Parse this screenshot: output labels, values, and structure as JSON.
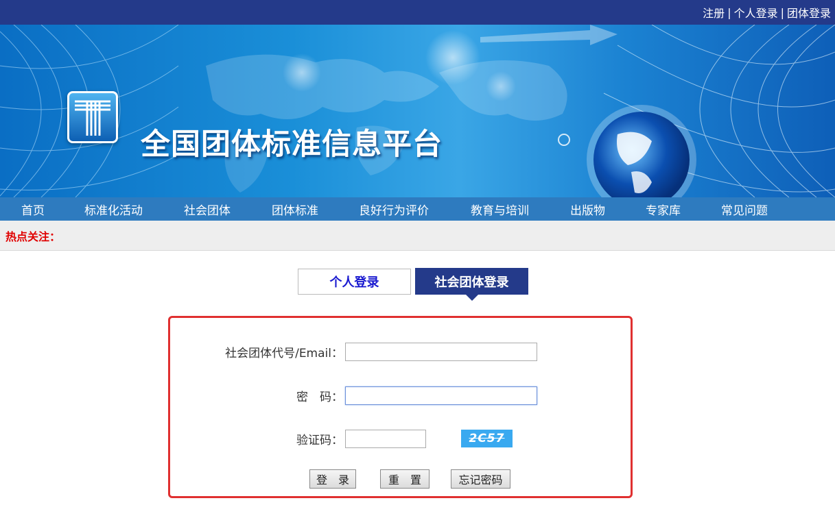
{
  "topbar": {
    "register": "注册",
    "personal_login": "个人登录",
    "group_login": "团体登录",
    "separator": "|"
  },
  "banner": {
    "site_title": "全国团体标准信息平台",
    "logo_icon": "t-logo-icon"
  },
  "nav": {
    "items": [
      "首页",
      "标准化活动",
      "社会团体",
      "团体标准",
      "良好行为评价",
      "教育与培训",
      "出版物",
      "专家库",
      "常见问题"
    ]
  },
  "hot": {
    "label": "热点关注："
  },
  "tabs": {
    "personal": "个人登录",
    "group": "社会团体登录"
  },
  "form": {
    "account_label": "社会团体代号/Email：",
    "account_value": "",
    "password_label": "密　码：",
    "password_value": "",
    "captcha_label": "验证码：",
    "captcha_value": "",
    "captcha_text": "2C57",
    "login_button": "登　录",
    "reset_button": "重　置",
    "forgot_button": "忘记密码"
  },
  "colors": {
    "topbar": "#243a8a",
    "nav": "#2e7bbf",
    "active_tab": "#243a8a",
    "form_border": "#e03030",
    "hot_label": "#e00000"
  }
}
